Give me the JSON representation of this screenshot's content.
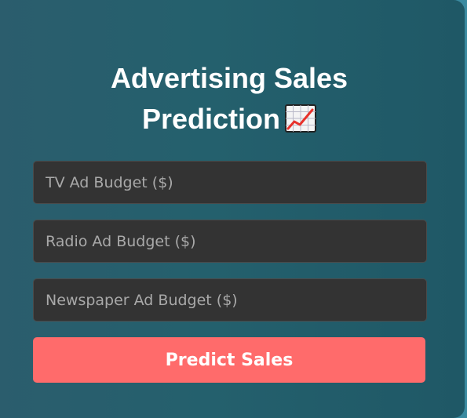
{
  "form": {
    "title_line1": "Advertising Sales",
    "title_line2": "Prediction",
    "title_icon": "chart-increasing-icon",
    "fields": [
      {
        "placeholder": "TV Ad Budget ($)",
        "value": ""
      },
      {
        "placeholder": "Radio Ad Budget ($)",
        "value": ""
      },
      {
        "placeholder": "Newspaper Ad Budget ($)",
        "value": ""
      }
    ],
    "submit_label": "Predict Sales"
  },
  "colors": {
    "card_gradient_start": "#2b5d6d",
    "card_gradient_end": "#1f5866",
    "input_background": "#333333",
    "button_background": "#ff6b6b",
    "title_text": "#ffffff"
  }
}
